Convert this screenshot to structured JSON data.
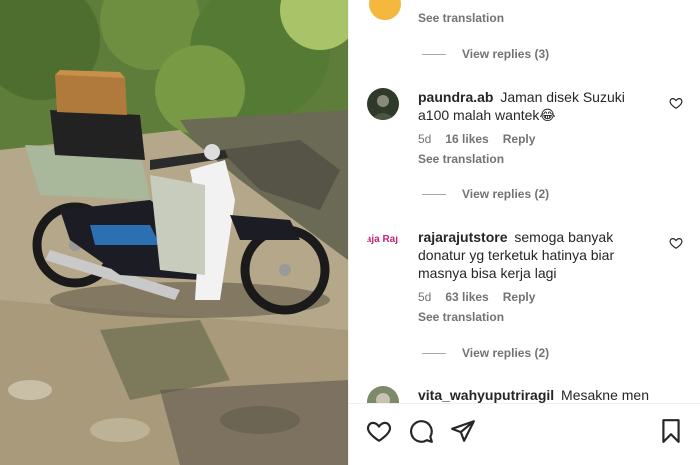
{
  "post": {
    "photo_alt_icon": "motorcycle-photo"
  },
  "top": {
    "translate_label": "See translation"
  },
  "threads": [
    {
      "view_replies_label": "View replies (3)"
    },
    {
      "view_replies_label": "View replies (2)"
    },
    {
      "view_replies_label": "View replies (2)"
    }
  ],
  "comments": [
    {
      "username": "paundra.ab",
      "text": "Jaman disek Suzuki a100 malah wantek😂",
      "age": "5d",
      "likes": "16 likes",
      "reply_label": "Reply",
      "translate_label": "See translation"
    },
    {
      "username": "rajarajutstore",
      "text": "semoga banyak donatur yg terketuk hatinya biar masnya bisa kerja lagi",
      "age": "5d",
      "likes": "63 likes",
      "reply_label": "Reply",
      "translate_label": "See translation",
      "avatar_text": "Raja Rajut"
    },
    {
      "username": "vita_wahyuputriragil",
      "text": "Mesakne men"
    }
  ],
  "actions": {
    "like_icon": "heart-icon",
    "comment_icon": "comment-icon",
    "share_icon": "send-icon",
    "save_icon": "bookmark-icon"
  },
  "colors": {
    "text": "#262626",
    "muted": "#737373",
    "divider": "#efefef"
  }
}
